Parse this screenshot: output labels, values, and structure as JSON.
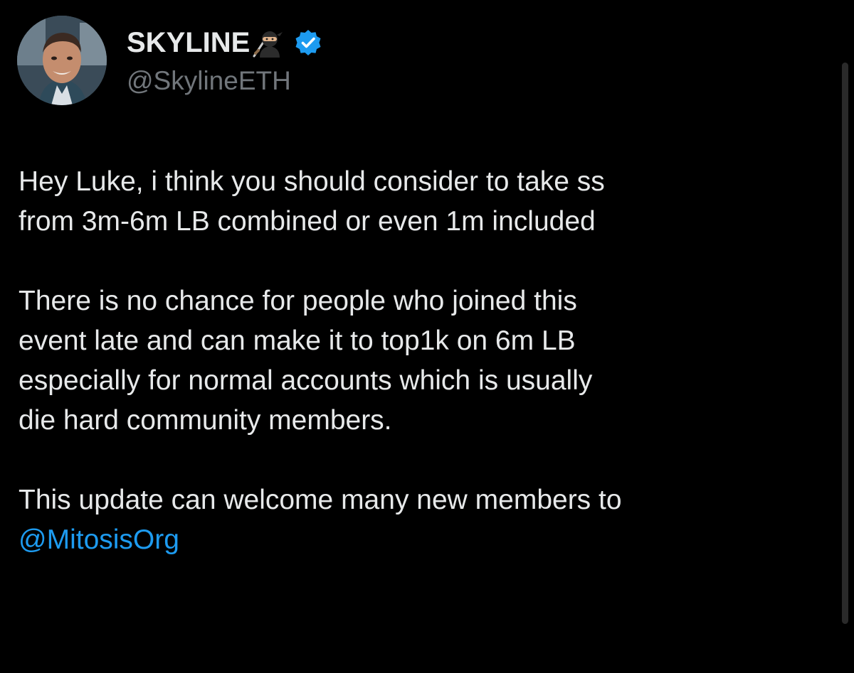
{
  "author": {
    "display_name": "SKYLINE",
    "emoji_icon": "ninja-icon",
    "verified_icon": "verified-badge-icon",
    "handle": "@SkylineETH"
  },
  "tweet": {
    "paragraph_1_line_1": "Hey Luke, i think you should consider to take ss",
    "paragraph_1_line_2": "from 3m-6m LB combined or even 1m included",
    "paragraph_2_line_1": "There is no chance for people who joined this",
    "paragraph_2_line_2": "event late and can make it to top1k on 6m LB",
    "paragraph_2_line_3": "especially for normal accounts which is usually",
    "paragraph_2_line_4": "die hard community members.",
    "paragraph_3_line_1": "This update can welcome many new members to",
    "mention": "@MitosisOrg"
  },
  "colors": {
    "background": "#000000",
    "text": "#e7e9ea",
    "secondary_text": "#71767b",
    "link": "#1d9bf0",
    "verified": "#1d9bf0"
  }
}
